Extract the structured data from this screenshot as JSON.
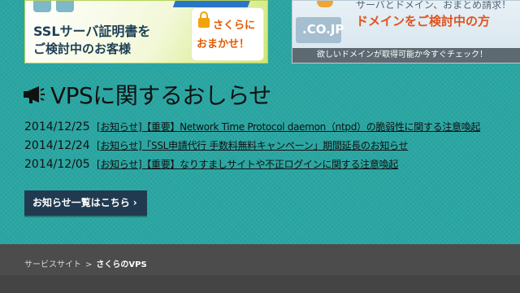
{
  "banners": {
    "ssl": {
      "title": "SSLサーバ証明書を",
      "subtitle": "ご検討中のお客様",
      "bubble_line1": "さくらに",
      "bubble_line2": "おまかせ！"
    },
    "domain": {
      "badge": ".CO.JP",
      "line1": "サーバとドメイン、おまとめ請求！",
      "line2": "ドメインをご検討中の方",
      "footer": "欲しいドメインが取得可能か今すぐチェック！"
    }
  },
  "news": {
    "heading": "VPSに関するおしらせ",
    "items": [
      {
        "date": "2014/12/25",
        "title": "[お知らせ]【重要】Network Time Protocol daemon（ntpd）の脆弱性に関する注意喚起"
      },
      {
        "date": "2014/12/24",
        "title": "[お知らせ]「SSL申請代行 手数料無料キャンペーン」期間延長のお知らせ"
      },
      {
        "date": "2014/12/05",
        "title": "[お知らせ]【重要】なりすましサイトや不正ログインに関する注意喚起"
      }
    ],
    "all_button": "お知らせ一覧はこちら",
    "all_button_arrow": "›"
  },
  "footer": {
    "breadcrumb": [
      {
        "label": "サービスサイト"
      },
      {
        "label": "さくらのVPS"
      }
    ],
    "separator": ">"
  }
}
